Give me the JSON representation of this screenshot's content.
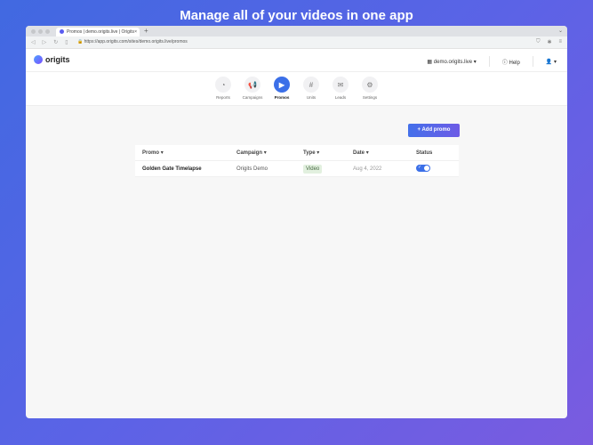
{
  "headline": "Manage all of your videos in one app",
  "browser": {
    "tab_title": "Promos | demo.origits.live | Origits",
    "url": "https://app.origits.com/sites/demo.origits.live/promos"
  },
  "app": {
    "logo": "origits",
    "site_selector": "demo.origits.live",
    "help": "Help"
  },
  "nav": [
    {
      "label": "Reports",
      "icon": "◔"
    },
    {
      "label": "Campaigns",
      "icon": "📢"
    },
    {
      "label": "Promos",
      "icon": "▶"
    },
    {
      "label": "Units",
      "icon": "#"
    },
    {
      "label": "Leads",
      "icon": "✉"
    },
    {
      "label": "Settings",
      "icon": "⚙"
    }
  ],
  "add_button": "+ Add promo",
  "table": {
    "headers": [
      "Promo",
      "Campaign",
      "Type",
      "Date",
      "Status"
    ],
    "rows": [
      {
        "promo": "Golden Gate Timelapse",
        "campaign": "Origits Demo",
        "type": "Video",
        "date": "Aug 4, 2022",
        "status": "on"
      }
    ]
  }
}
